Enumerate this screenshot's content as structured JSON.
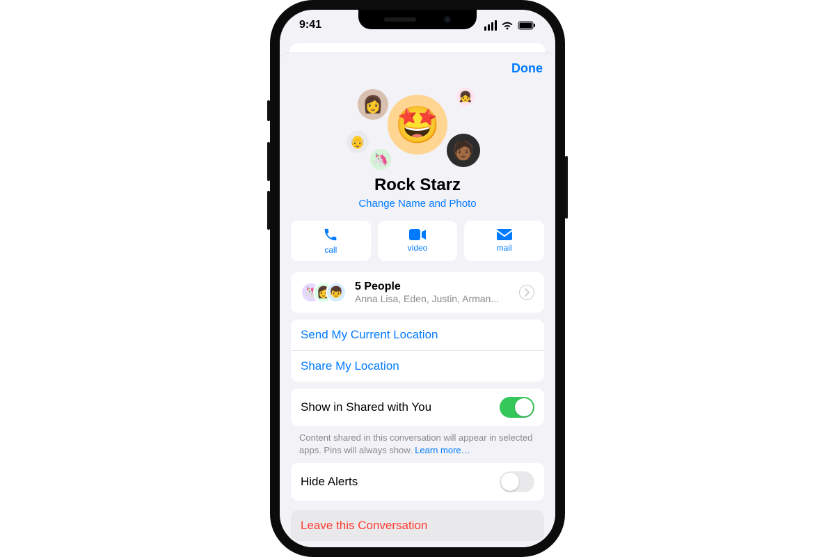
{
  "status": {
    "time": "9:41"
  },
  "sheet": {
    "done": "Done",
    "group_name": "Rock Starz",
    "change_link": "Change Name and Photo",
    "main_emoji": "🤩"
  },
  "actions": {
    "call": "call",
    "video": "video",
    "mail": "mail"
  },
  "people": {
    "title": "5 People",
    "subtitle": "Anna Lisa, Eden, Justin, Arman..."
  },
  "location": {
    "send_current": "Send My Current Location",
    "share": "Share My Location"
  },
  "shared": {
    "label": "Show in Shared with You",
    "on": true,
    "footer_text": "Content shared in this conversation will appear in selected apps. Pins will always show. ",
    "footer_link": "Learn more…"
  },
  "alerts": {
    "label": "Hide Alerts",
    "on": false
  },
  "leave": {
    "label": "Leave this Conversation"
  }
}
